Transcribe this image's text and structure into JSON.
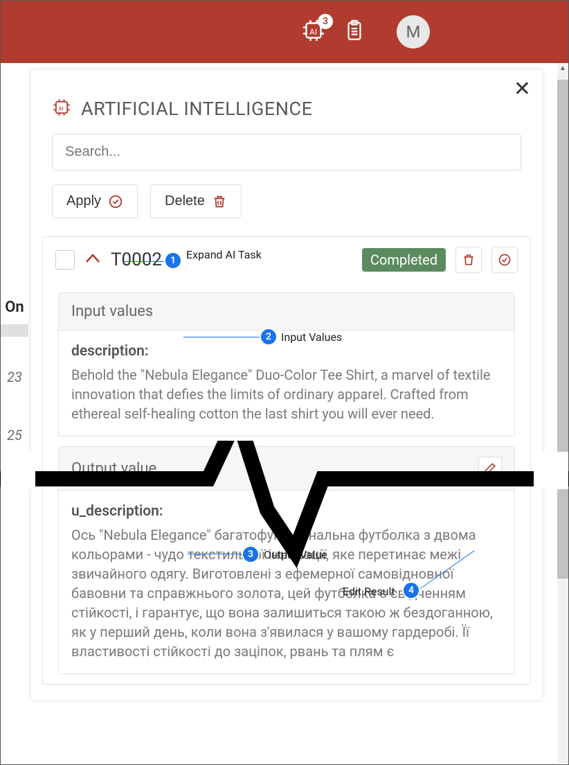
{
  "topbar": {
    "ai_badge": "3",
    "avatar_initial": "M"
  },
  "left": {
    "on": "On",
    "n23": "23",
    "n25": "25"
  },
  "panel": {
    "title": "ARTIFICIAL INTELLIGENCE",
    "search_placeholder": "Search...",
    "apply": "Apply",
    "delete": "Delete"
  },
  "task": {
    "id": "T0002",
    "status": "Completed",
    "input": {
      "heading": "Input values",
      "field_label": "description:",
      "field_text": "Behold the \"Nebula Elegance\" Duo-Color Tee Shirt, a marvel of textile innovation that defies the limits of ordinary apparel. Crafted from ethereal self-healing cotton the last shirt you will ever need."
    },
    "output": {
      "heading": "Output value",
      "field_label": "u_description:",
      "field_text": "Ось \"Nebula Elegance\" багатофункціональна футболка з двома кольорами - чудо текстильної інновації, яке перетинає межі звичайного одягу. Виготовлені з ефемерної самовідновної бавовни та справжнього золота, цей футболка є свідченням стійкості, і гарантує, що вона залишиться такою ж бездоганною, як у перший день, коли вона з'явилася у вашому гардеробі. Її властивості стійкості до заціпок, рвань та плям є"
    }
  },
  "callouts": {
    "c1": "Expand AI Task",
    "c2": "Input Values",
    "c3": "Output Value",
    "c4": "Edit Result"
  }
}
